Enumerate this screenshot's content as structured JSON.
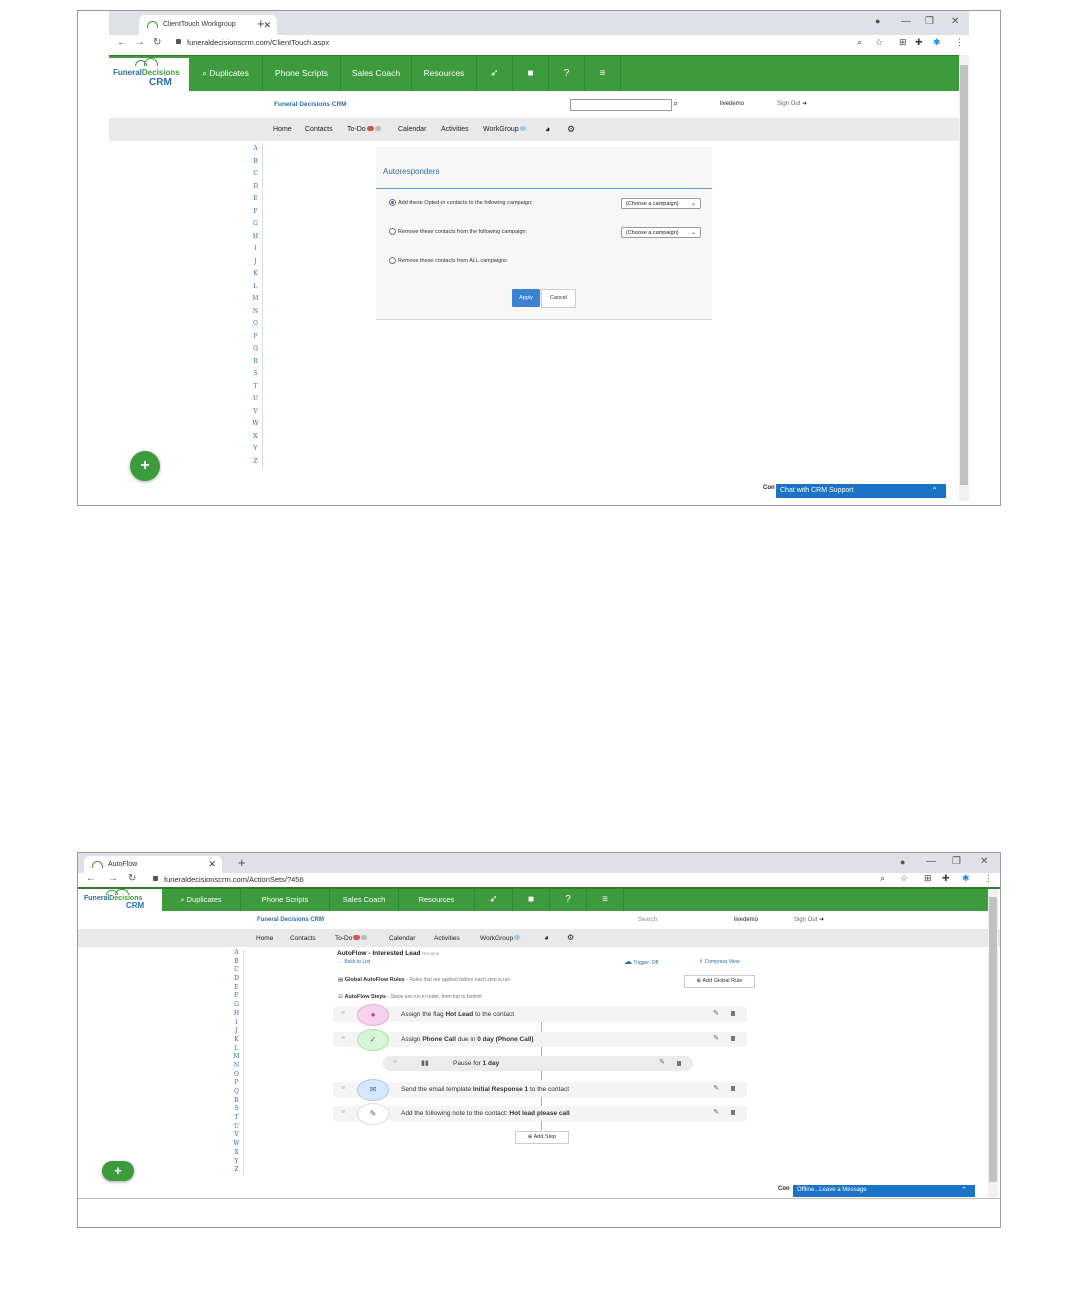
{
  "top": {
    "tab_title": "ClientTouch Workgroup",
    "url": "funeraldecisionscrm.com/ClientTouch.aspx",
    "logo_line1a": "Funeral",
    "logo_line1b": "Decisions",
    "logo_line2": "CRM",
    "nav": {
      "duplicates": "Duplicates",
      "phone_scripts": "Phone Scripts",
      "sales_coach": "Sales Coach",
      "resources": "Resources"
    },
    "brand_link": "Funeral Decisions CRM",
    "user": "livedemo",
    "sign_out": "Sign Out",
    "menu": {
      "home": "Home",
      "contacts": "Contacts",
      "todo": "To-Do",
      "calendar": "Calendar",
      "activities": "Activities",
      "workgroup": "WorkGroup"
    },
    "alphabet": [
      "A",
      "B",
      "C",
      "D",
      "E",
      "F",
      "G",
      "H",
      "I",
      "J",
      "K",
      "L",
      "M",
      "N",
      "O",
      "P",
      "Q",
      "R",
      "S",
      "T",
      "U",
      "V",
      "W",
      "X",
      "Y",
      "Z"
    ],
    "autoresponders": {
      "title": "Autoresponders",
      "opt1": "Add these Opted-in contacts to the following campaign:",
      "opt2": "Remove these contacts from the following campaign:",
      "opt3": "Remove these contacts from ALL campaigns",
      "select": "(Choose a campaign)",
      "apply": "Apply",
      "cancel": "Cancel"
    },
    "fab": "+",
    "trunc": "Con",
    "chat": "Chat with CRM Support"
  },
  "bottom": {
    "tab_title": "AutoFlow",
    "url": "funeraldecisionscrm.com/ActionSets/?456",
    "logo_line1a": "Funeral",
    "logo_line1b": "Decisions",
    "logo_line2": "CRM",
    "nav": {
      "duplicates": "Duplicates",
      "phone_scripts": "Phone Scripts",
      "sales_coach": "Sales Coach",
      "resources": "Resources"
    },
    "brand_link": "Funeral Decisions CRM",
    "search": "Search",
    "user": "livedemo",
    "sign_out": "Sign Out",
    "menu": {
      "home": "Home",
      "contacts": "Contacts",
      "todo": "To-Do",
      "calendar": "Calendar",
      "activities": "Activities",
      "workgroup": "WorkGroup"
    },
    "alphabet": [
      "A",
      "B",
      "C",
      "D",
      "E",
      "F",
      "G",
      "H",
      "I",
      "J",
      "K",
      "L",
      "M",
      "N",
      "O",
      "P",
      "Q",
      "R",
      "S",
      "T",
      "U",
      "V",
      "W",
      "X",
      "Y",
      "Z"
    ],
    "autoflow": {
      "title": "AutoFlow - Interested Lead",
      "rename": "Rename",
      "back": "Back to List",
      "trigger": "Trigger: Off",
      "compress": "Compress View",
      "global_rules": "Global AutoFlow Rules",
      "global_rules_desc": "- Rules that are applied before each step is run",
      "add_global_rule": "Add Global Rule",
      "steps": "AutoFlow Steps",
      "steps_desc": "- Steps are run in order, from top to bottom",
      "step1_pre": "Assign the flag ",
      "step1_b": "Hot Lead",
      "step1_post": " to the contact",
      "step2_pre": "Assign ",
      "step2_b1": "Phone Call",
      "step2_mid": " due in ",
      "step2_b2": "0 day (Phone Call)",
      "pause_pre": "Pause for ",
      "pause_b": "1 day",
      "step3_pre": "Send the email template ",
      "step3_b": "Initial Response 1",
      "step3_post": " to the contact",
      "step4_pre": "Add the following note to the contact: ",
      "step4_b": "Hot lead please call",
      "add_step": "Add Step"
    },
    "fab": "+",
    "trunc": "Con",
    "chat": "Offline...Leave a Message"
  }
}
